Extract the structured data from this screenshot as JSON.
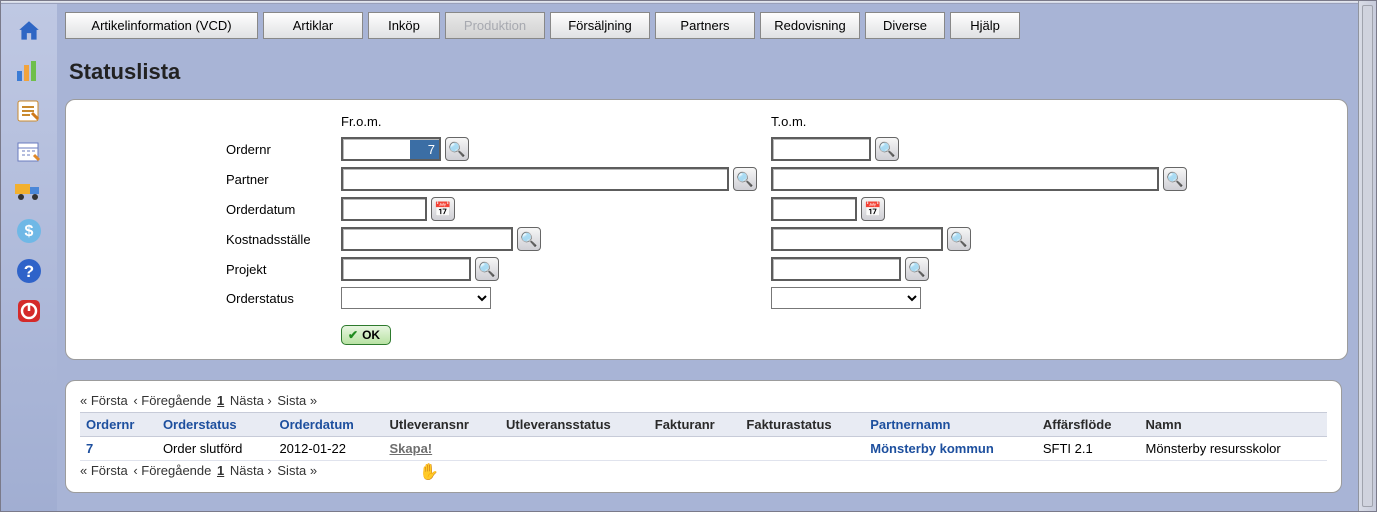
{
  "tabs": {
    "artikelinfo": "Artikelinformation (VCD)",
    "artiklar": "Artiklar",
    "inkop": "Inköp",
    "produktion": "Produktion",
    "forsaljning": "Försäljning",
    "partners": "Partners",
    "redovisning": "Redovisning",
    "diverse": "Diverse",
    "hjalp": "Hjälp"
  },
  "page": {
    "title": "Statuslista"
  },
  "filter": {
    "col_from": "Fr.o.m.",
    "col_to": "T.o.m.",
    "labels": {
      "ordernr": "Ordernr",
      "partner": "Partner",
      "orderdatum": "Orderdatum",
      "kostnadsstalle": "Kostnadsställe",
      "projekt": "Projekt",
      "orderstatus": "Orderstatus"
    },
    "values": {
      "ordernr_from": "7",
      "ordernr_to": "",
      "partner_from": "",
      "partner_to": "",
      "orderdatum_from": "",
      "orderdatum_to": "",
      "kostnad_from": "",
      "kostnad_to": "",
      "projekt_from": "",
      "projekt_to": "",
      "orderstatus_from": "",
      "orderstatus_to": ""
    },
    "ok_label": "OK"
  },
  "pager": {
    "first": "« Första",
    "prev": "‹ Föregående",
    "page": "1",
    "next": "Nästa ›",
    "last": "Sista »"
  },
  "table": {
    "headers": {
      "ordernr": "Ordernr",
      "orderstatus": "Orderstatus",
      "orderdatum": "Orderdatum",
      "utleveransnr": "Utleveransnr",
      "utleveransstatus": "Utleveransstatus",
      "fakturanr": "Fakturanr",
      "fakturastatus": "Fakturastatus",
      "partnernamn": "Partnernamn",
      "affarsflode": "Affärsflöde",
      "namn": "Namn"
    },
    "row": {
      "ordernr": "7",
      "orderstatus": "Order slutförd",
      "orderdatum": "2012-01-22",
      "utleveransnr": "Skapa!",
      "utleveransstatus": "",
      "fakturanr": "",
      "fakturastatus": "",
      "partnernamn": "Mönsterby kommun",
      "affarsflode": "SFTI 2.1",
      "namn": "Mönsterby resursskolor"
    }
  }
}
